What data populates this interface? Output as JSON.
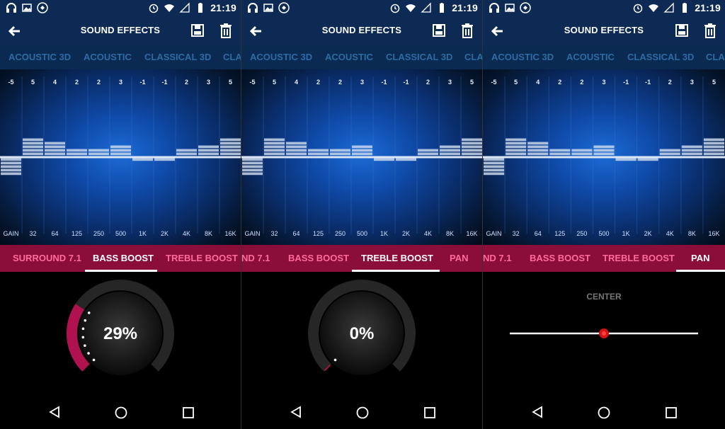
{
  "status": {
    "time": "21:19"
  },
  "toolbar": {
    "title": "SOUND EFFECTS"
  },
  "presets": [
    "ACOUSTIC 3D",
    "ACOUSTIC",
    "CLASSICAL 3D",
    "CLA"
  ],
  "eq": {
    "values": [
      "-5",
      "5",
      "4",
      "2",
      "2",
      "3",
      "-1",
      "-1",
      "2",
      "3",
      "5"
    ],
    "levels": [
      -5,
      5,
      4,
      2,
      2,
      3,
      -1,
      -1,
      2,
      3,
      5
    ],
    "freqs": [
      "GAIN",
      "32",
      "64",
      "125",
      "250",
      "500",
      "1K",
      "2K",
      "4K",
      "8K",
      "16K"
    ]
  },
  "tabs": [
    "SURROUND 7.1",
    "BASS BOOST",
    "TREBLE BOOST",
    "PAN"
  ],
  "panels": [
    {
      "active_tab": "BASS BOOST",
      "tabs_visible": [
        "SURROUND 7.1",
        "BASS BOOST",
        "TREBLE BOOST"
      ],
      "knob": {
        "value": "29%",
        "fraction": 0.29
      }
    },
    {
      "active_tab": "TREBLE BOOST",
      "tabs_visible": [
        "ND 7.1",
        "BASS BOOST",
        "TREBLE BOOST",
        "PAN"
      ],
      "knob": {
        "value": "0%",
        "fraction": 0.0
      }
    },
    {
      "active_tab": "PAN",
      "tabs_visible": [
        "ND 7.1",
        "BASS BOOST",
        "TREBLE BOOST",
        "PAN"
      ],
      "pan": {
        "label": "CENTER",
        "position": 0.5
      }
    }
  ],
  "colors": {
    "toolbar": "#0d2a55",
    "accent_red": "#8b0d3a",
    "accent_pink": "#ff6b9a",
    "bar_fill": "#c8d6ea"
  }
}
